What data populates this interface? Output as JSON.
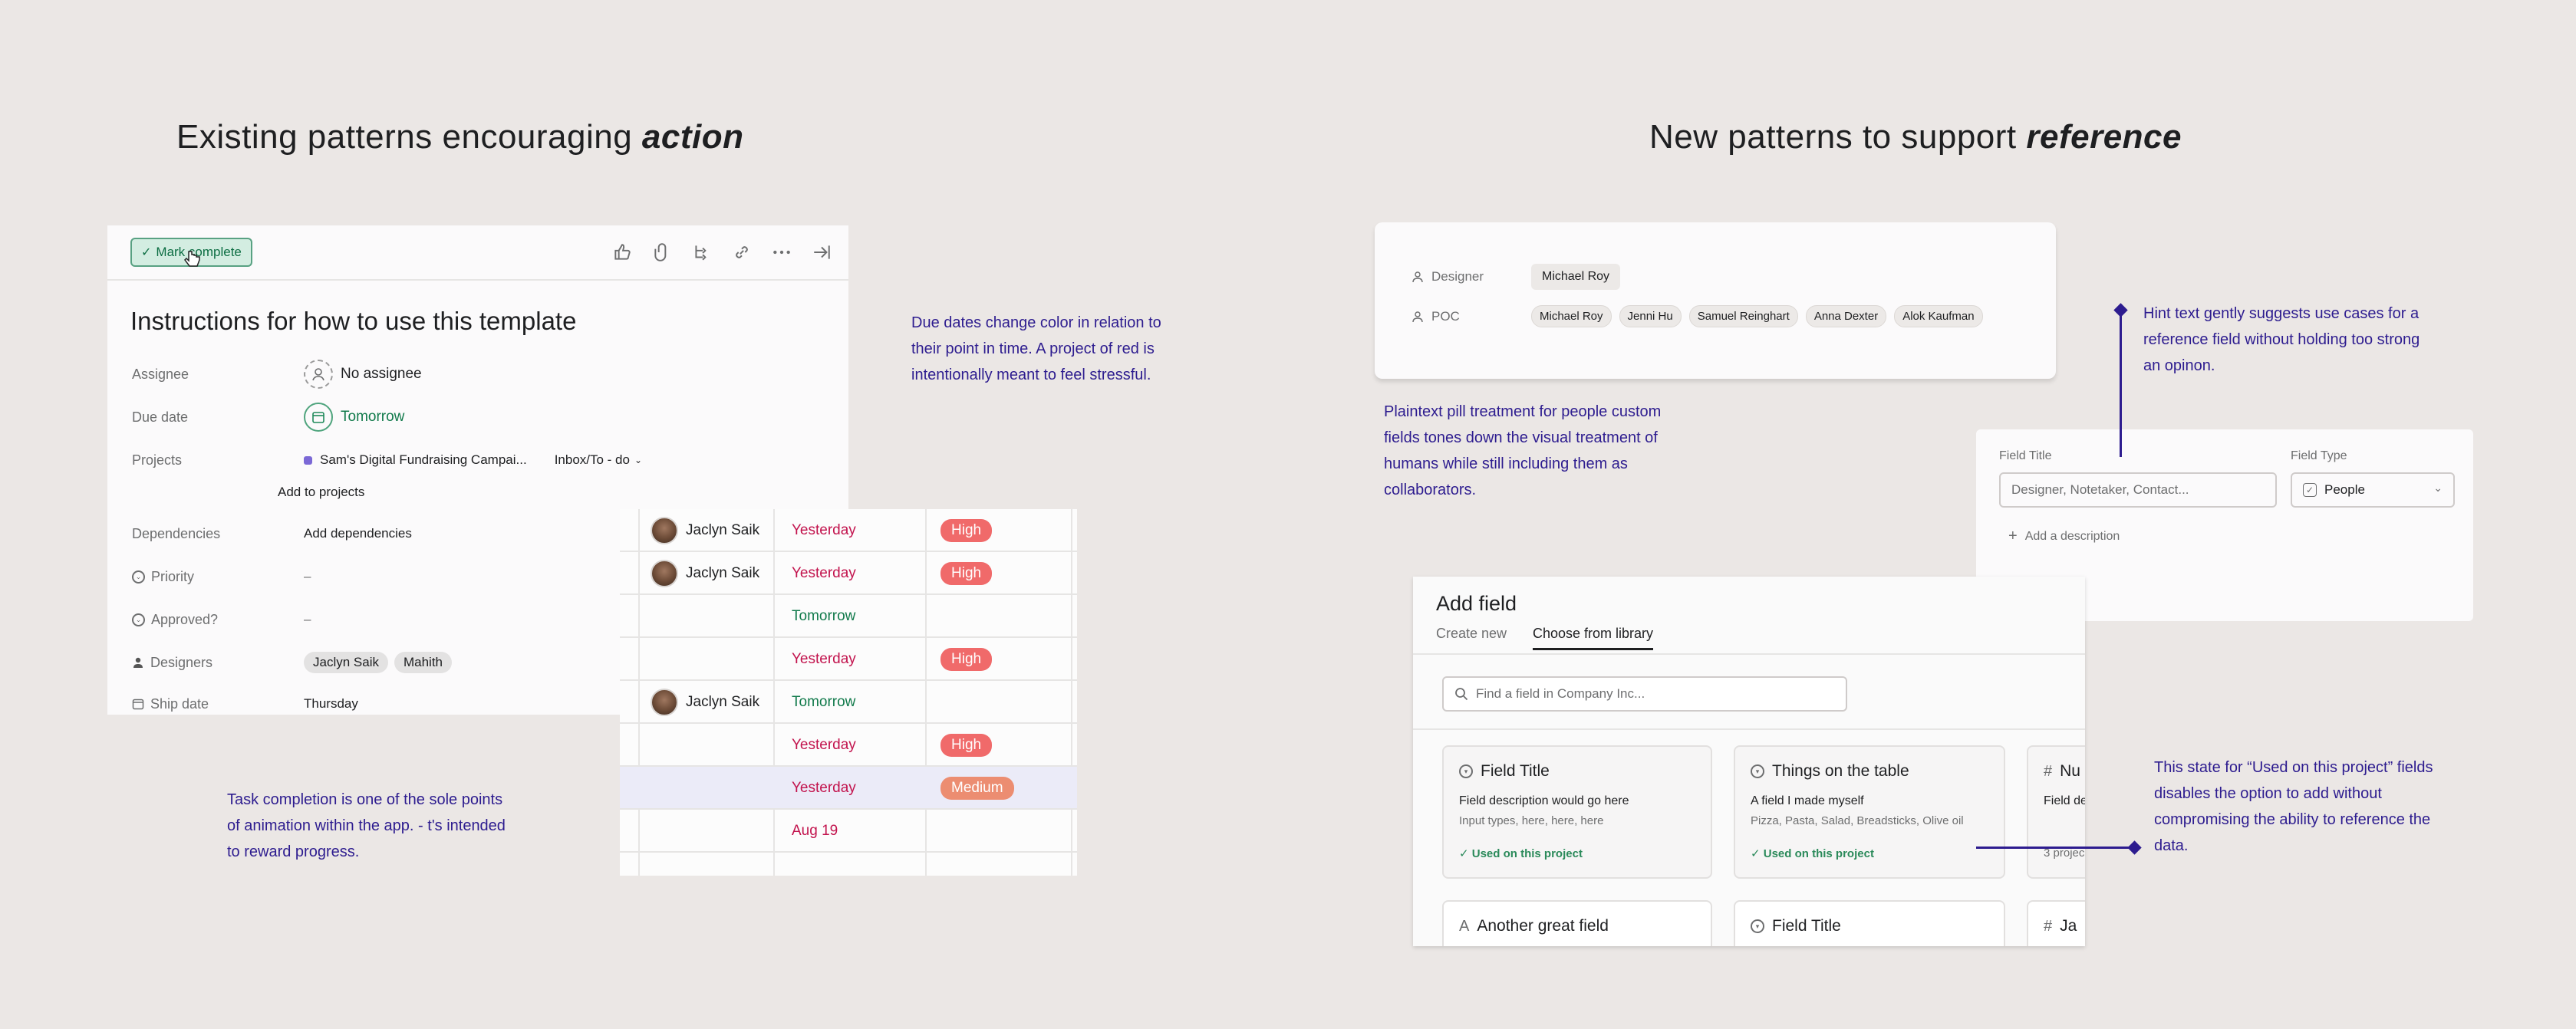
{
  "headings": {
    "left_plain": "Existing patterns encouraging ",
    "left_em": "action",
    "right_plain": "New patterns to support ",
    "right_em": "reference"
  },
  "notes": {
    "due_dates": "Due dates change color in relation to their point in time. A project of red is intentionally meant to feel stressful.",
    "task_completion": "Task completion is one of the sole points of animation within the app. - t's intended to reward progress.",
    "plaintext_pill": "Plaintext pill treatment for people custom fields tones down the visual treatment of humans while still including them as collaborators.",
    "hint_text": "Hint text gently suggests use cases for a reference field without holding too strong an opinon.",
    "used_state": "This state for “Used on this project” fields disables the option to add without compromising the ability to reference the data."
  },
  "task_panel": {
    "mark_complete": "Mark complete",
    "title": "Instructions for how to use this template",
    "fields": {
      "assignee_label": "Assignee",
      "assignee_value": "No assignee",
      "due_label": "Due date",
      "due_value": "Tomorrow",
      "projects_label": "Projects",
      "project_name": "Sam's Digital Fundraising Campai...",
      "project_section": "Inbox/To - do",
      "add_projects": "Add to projects",
      "dependencies_label": "Dependencies",
      "dependencies_value": "Add dependencies",
      "priority_label": "Priority",
      "priority_value": "–",
      "approved_label": "Approved?",
      "approved_value": "–",
      "designers_label": "Designers",
      "designer_1": "Jaclyn Saik",
      "designer_2": "Mahith",
      "ship_label": "Ship date",
      "ship_value": "Thursday"
    }
  },
  "table": {
    "rows": [
      {
        "person": "Jaclyn Saik",
        "date": "Yesterday",
        "date_color": "#c2134d",
        "priority": "High",
        "priority_color": "#f06a6a"
      },
      {
        "person": "Jaclyn Saik",
        "date": "Yesterday",
        "date_color": "#c2134d",
        "priority": "High",
        "priority_color": "#f06a6a"
      },
      {
        "person": "",
        "date": "Tomorrow",
        "date_color": "#117a4b",
        "priority": "",
        "priority_color": ""
      },
      {
        "person": "",
        "date": "Yesterday",
        "date_color": "#c2134d",
        "priority": "High",
        "priority_color": "#f06a6a"
      },
      {
        "person": "Jaclyn Saik",
        "date": "Tomorrow",
        "date_color": "#117a4b",
        "priority": "",
        "priority_color": ""
      },
      {
        "person": "",
        "date": "Yesterday",
        "date_color": "#c2134d",
        "priority": "High",
        "priority_color": "#f06a6a"
      },
      {
        "person": "",
        "date": "Yesterday",
        "date_color": "#c2134d",
        "priority": "Medium",
        "priority_color": "#ec8d71"
      },
      {
        "person": "",
        "date": "Aug 19",
        "date_color": "#c2134d",
        "priority": "",
        "priority_color": ""
      }
    ]
  },
  "people_card": {
    "designer_label": "Designer",
    "designer_pill": "Michael Roy",
    "poc_label": "POC",
    "poc_pills": [
      "Michael Roy",
      "Jenni Hu",
      "Samuel Reinghart",
      "Anna Dexter",
      "Alok Kaufman"
    ]
  },
  "field_form": {
    "title_label": "Field Title",
    "title_placeholder": "Designer, Notetaker, Contact...",
    "type_label": "Field Type",
    "type_value": "People",
    "add_description": "Add a description"
  },
  "add_field": {
    "title": "Add field",
    "tab_create": "Create new",
    "tab_library": "Choose from library",
    "search_placeholder": "Find a field in Company Inc...",
    "cards": [
      {
        "title": "Field Title",
        "desc": "Field description would go here",
        "sub": "Input types, here, here, here",
        "used": "Used on this project"
      },
      {
        "title": "Things on the table",
        "desc": "A field I made myself",
        "sub": "Pizza, Pasta, Salad, Breadsticks, Olive oil",
        "used": "Used on this project"
      },
      {
        "title": "Nu",
        "desc": "Field de",
        "sub": "",
        "used": "3 projec"
      }
    ],
    "cards_row2": [
      {
        "title": "Another great field"
      },
      {
        "title": "Field Title"
      },
      {
        "title": "Ja"
      }
    ]
  }
}
